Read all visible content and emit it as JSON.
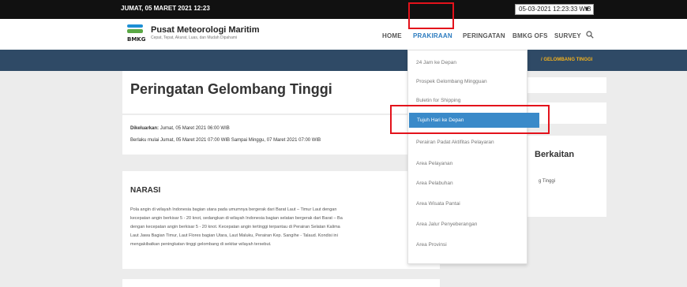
{
  "topbar": {
    "date": "JUMAT, 05 MARET 2021 12:23",
    "time_select": "05-03-2021 12:23:33 WIB"
  },
  "header": {
    "logo_text": "BMKG",
    "brand": "Pusat Meteorologi Maritim",
    "tagline": "Cepat, Tepat, Akurat, Luas, dan Mudah Dipahami",
    "nav": [
      "HOME",
      "PRAKIRAAN",
      "PERINGATAN",
      "BMKG OFS",
      "SURVEY"
    ]
  },
  "breadcrumb": {
    "current": "/   GELOMBANG TINGGI"
  },
  "page": {
    "title": "Peringatan Gelombang Tinggi",
    "issued_label": "Dikeluarkan:",
    "issued_value": "Jumat, 05 Maret 2021 06:00 WIB",
    "valid": "Berlaku mulai Jumat, 05 Maret 2021 07:00 WIB Sampai Minggu, 07 Maret 2021 07:00 WIB",
    "narasi_heading": "NARASI",
    "narasi_lines": [
      "Pola angin di wilayah Indonesia bagian utara pada umumnya bergerak dari Barat Laut – Timur Laut dengan",
      "kecepatan angin berkisar 5 - 20 knot, sedangkan di wilayah Indonesia bagian selatan bergerak dari Barat – Ba",
      "dengan kecepatan angin berkisar 5 - 20 knot. Kecepatan angin tertinggi terpantau di Perairan Selatan Kalima",
      "Laut Jawa Bagian Timur, Laut Flores bagian Utara, Laut Maluku, Perairan Kep. Sangihe - Talaud. Kondisi ini",
      "mengakibatkan peningkatan tinggi gelombang di sekitar wilayah tersebut."
    ],
    "related_heading": "Berkaitan",
    "related_item": "g Tinggi"
  },
  "dropdown": {
    "items": [
      "24 Jam ke Depan",
      "Prospek Gelombang Mingguan",
      "Buletin for Shipping",
      "Tujuh Hari ke Depan",
      "Perairan Padat Aktifitas Pelayaran",
      "Area Pelayanan",
      "Area Pelabuhan",
      "Area Wisata Pantai",
      "Area Jalur Penyeberangan",
      "Area Provinsi"
    ],
    "highlighted": "Tujuh Hari ke Depan"
  },
  "colors": {
    "accent": "#2b7bbf",
    "highlight": "#3a8ac9",
    "annotation": "#e3121b",
    "band": "#2f4a66",
    "crumb": "#f3b11d"
  }
}
